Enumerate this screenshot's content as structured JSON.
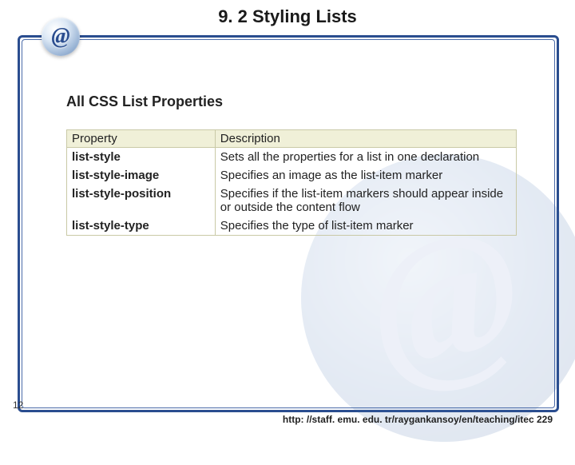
{
  "logo_glyph": "@",
  "title": "9. 2 Styling Lists",
  "subtitle": "All CSS List Properties",
  "table": {
    "headers": {
      "col1": "Property",
      "col2": "Description"
    },
    "rows": [
      {
        "property": "list-style",
        "description": "Sets all the properties for a list in one declaration"
      },
      {
        "property": "list-style-image",
        "description": "Specifies an image as the list-item marker"
      },
      {
        "property": "list-style-position",
        "description": "Specifies if the list-item markers should appear inside or outside the content flow"
      },
      {
        "property": "list-style-type",
        "description": "Specifies the type of list-item marker"
      }
    ]
  },
  "page_number": "12",
  "footer_url": "http: //staff. emu. edu. tr/raygankansoy/en/teaching/itec 229",
  "watermark_glyph": "@"
}
